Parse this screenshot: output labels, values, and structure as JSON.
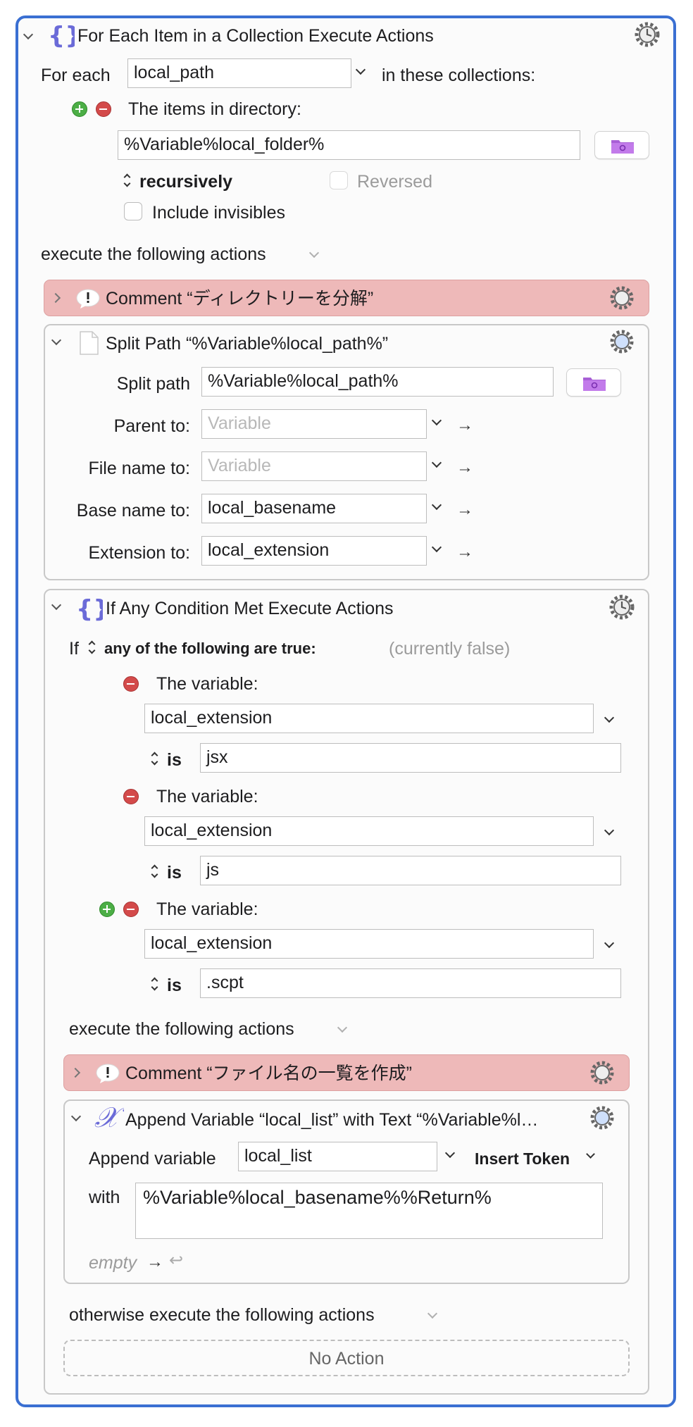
{
  "for_each": {
    "title": "For Each Item in a Collection Execute Actions",
    "for_each_label": "For each",
    "variable_value": "local_path",
    "in_collections_label": "in these collections:",
    "collection_label": "The items in directory:",
    "directory_value": "%Variable%local_folder%",
    "recursively_label": "recursively",
    "reversed_label": "Reversed",
    "include_invisibles_label": "Include invisibles",
    "execute_label": "execute the following actions"
  },
  "comment1": {
    "title": "Comment “ディレクトリーを分解”"
  },
  "split_path": {
    "title": "Split Path “%Variable%local_path%”",
    "split_path_label": "Split path",
    "split_path_value": "%Variable%local_path%",
    "parent_label": "Parent to:",
    "parent_placeholder": "Variable",
    "file_name_label": "File name to:",
    "file_name_placeholder": "Variable",
    "base_name_label": "Base name to:",
    "base_name_value": "local_basename",
    "extension_label": "Extension to:",
    "extension_value": "local_extension"
  },
  "if_condition": {
    "title": "If Any Condition Met Execute Actions",
    "if_label": "If",
    "condition_mode": "any of the following are true:",
    "state": "(currently false)",
    "conditions": [
      {
        "label": "The variable:",
        "variable": "local_extension",
        "operator": "is",
        "value": "jsx"
      },
      {
        "label": "The variable:",
        "variable": "local_extension",
        "operator": "is",
        "value": "js"
      },
      {
        "label": "The variable:",
        "variable": "local_extension",
        "operator": "is",
        "value": ".scpt"
      }
    ],
    "execute_label": "execute the following actions",
    "otherwise_label": "otherwise execute the following actions",
    "no_action_label": "No Action"
  },
  "comment2": {
    "title": "Comment “ファイル名の一覧を作成”"
  },
  "append": {
    "title": "Append Variable “local_list” with Text “%Variable%l…",
    "append_label": "Append variable",
    "variable_value": "local_list",
    "insert_token_label": "Insert Token",
    "with_label": "with",
    "text_value": "%Variable%local_basename%%Return%",
    "empty_label": "empty"
  },
  "colors": {
    "accent": "#3a6fd2",
    "comment_bg": "#eeb9b9",
    "brace_purple": "#6b6bd8"
  }
}
